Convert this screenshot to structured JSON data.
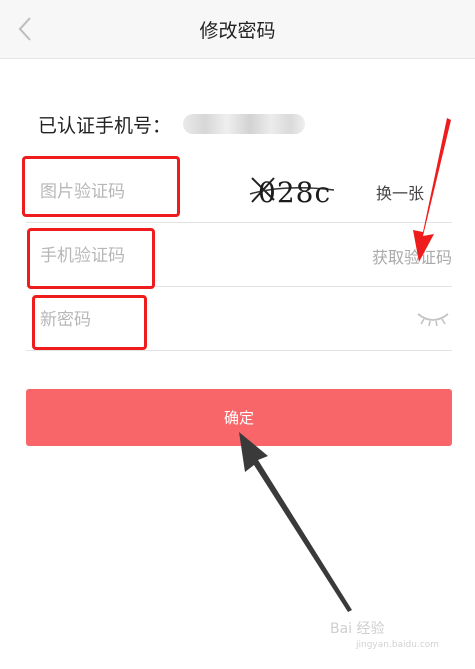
{
  "header": {
    "title": "修改密码"
  },
  "phone": {
    "label": "已认证手机号："
  },
  "fields": {
    "image_code_placeholder": "图片验证码",
    "captcha_text": "028c",
    "refresh_label": "换一张",
    "sms_code_placeholder": "手机验证码",
    "get_code_label": "获取验证码",
    "new_password_placeholder": "新密码"
  },
  "submit": {
    "label": "确定"
  },
  "watermark": {
    "text": "Bai 经验",
    "sub": "jingyan.baidu.com"
  },
  "colors": {
    "accent": "#f8666a",
    "annotation": "#ee1c1c",
    "arrow": "#3a3a3a"
  }
}
